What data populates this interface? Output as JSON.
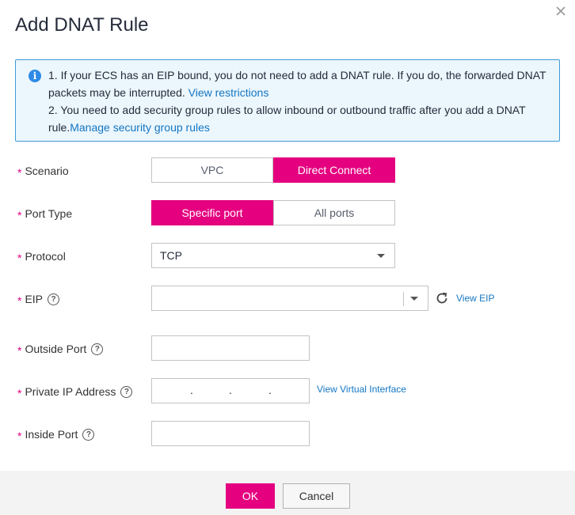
{
  "dialog": {
    "title": "Add DNAT Rule",
    "close_icon": "close-icon"
  },
  "info": {
    "icon": "info-icon",
    "line1_text": "1. If your ECS has an EIP bound, you do not need to add a DNAT rule. If you do, the forwarded DNAT packets may be interrupted.",
    "line1_link": "View restrictions",
    "line2_text": "2. You need to add security group rules to allow inbound or outbound traffic after you add a DNAT rule.",
    "line2_link": "Manage security group rules"
  },
  "form": {
    "scenario": {
      "label": "Scenario",
      "options": [
        "VPC",
        "Direct Connect"
      ],
      "selected": "Direct Connect"
    },
    "port_type": {
      "label": "Port Type",
      "options": [
        "Specific port",
        "All ports"
      ],
      "selected": "Specific port"
    },
    "protocol": {
      "label": "Protocol",
      "value": "TCP"
    },
    "eip": {
      "label": "EIP",
      "value": "",
      "link": "View EIP"
    },
    "outside_port": {
      "label": "Outside Port",
      "value": ""
    },
    "private_ip": {
      "label": "Private IP Address",
      "dots": [
        ".",
        ".",
        "."
      ],
      "link": "View Virtual Interface"
    },
    "inside_port": {
      "label": "Inside Port",
      "value": ""
    },
    "required_mark": "*",
    "help_mark": "?"
  },
  "footer": {
    "ok_label": "OK",
    "cancel_label": "Cancel"
  },
  "colors": {
    "accent": "#e4007f",
    "link": "#1476c2",
    "info_border": "#3e9bd6",
    "info_bg": "#ebf6fd"
  }
}
